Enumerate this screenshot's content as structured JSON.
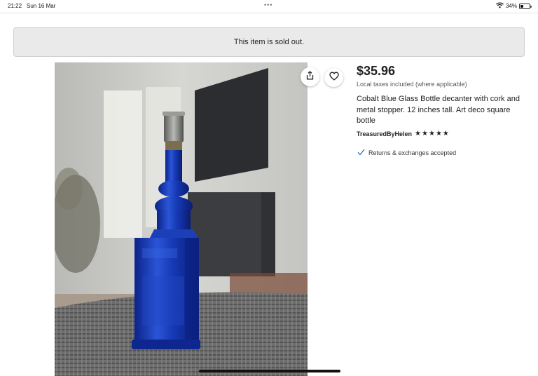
{
  "status_bar": {
    "time": "21:22",
    "date": "Sun 16 Mar",
    "dots": "•••",
    "battery_percent": "34%"
  },
  "banner": {
    "text": "This item is sold out."
  },
  "product": {
    "image_alt": "Cobalt blue glass bottle with cork and metal stopper",
    "price": "$35.96",
    "tax_note": "Local taxes included (where applicable)",
    "title": "Cobalt Blue Glass Bottle decanter with cork and metal stopper. 12 inches tall. Art deco square bottle",
    "seller": "TreasuredByHelen",
    "rating_stars": 5,
    "star_glyph": "★",
    "returns": "Returns & exchanges accepted"
  },
  "icons": {
    "share": "share-icon",
    "favorite": "heart-icon",
    "returns_check": "check-icon",
    "wifi": "wifi-icon",
    "battery": "battery-icon"
  },
  "colors": {
    "banner_bg": "#eaeaea",
    "check": "#2a72b5",
    "bottle_blue": "#1a3fb0",
    "text": "#222222"
  }
}
